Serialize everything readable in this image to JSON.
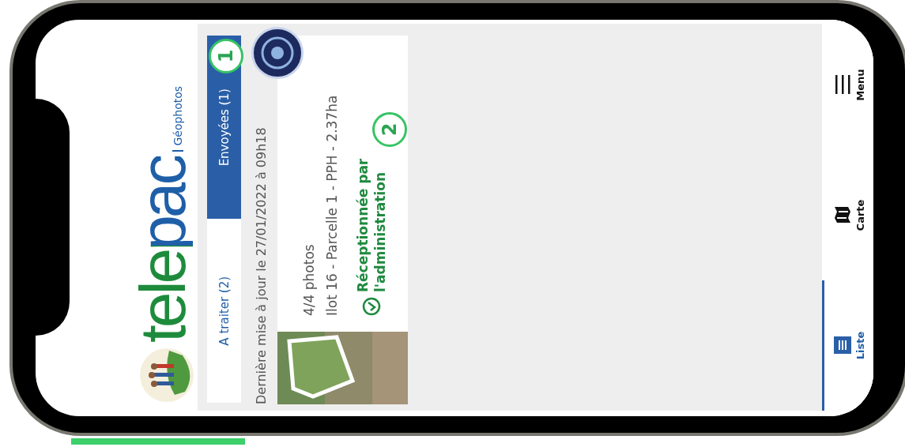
{
  "logo": {
    "wordmark": "telepac",
    "subtitle": "Géophotos"
  },
  "tabs": [
    {
      "label": "A traiter (2)",
      "selected": false
    },
    {
      "label": "Envoyées (1)",
      "selected": true
    }
  ],
  "last_update": "Dernière mise à jour le 27/01/2022 à 09h18",
  "cards": [
    {
      "photo_count": "4/4 photos",
      "parcel": "Ilot 16 - Parcelle 1 - PPH - 2.37ha",
      "status": "Réceptionnée par l'administration"
    }
  ],
  "annotations": [
    "1",
    "2"
  ],
  "nav": [
    {
      "label": "Liste",
      "kind": "list",
      "selected": true
    },
    {
      "label": "Carte",
      "kind": "map",
      "selected": false
    },
    {
      "label": "Menu",
      "kind": "menu",
      "selected": false
    }
  ]
}
